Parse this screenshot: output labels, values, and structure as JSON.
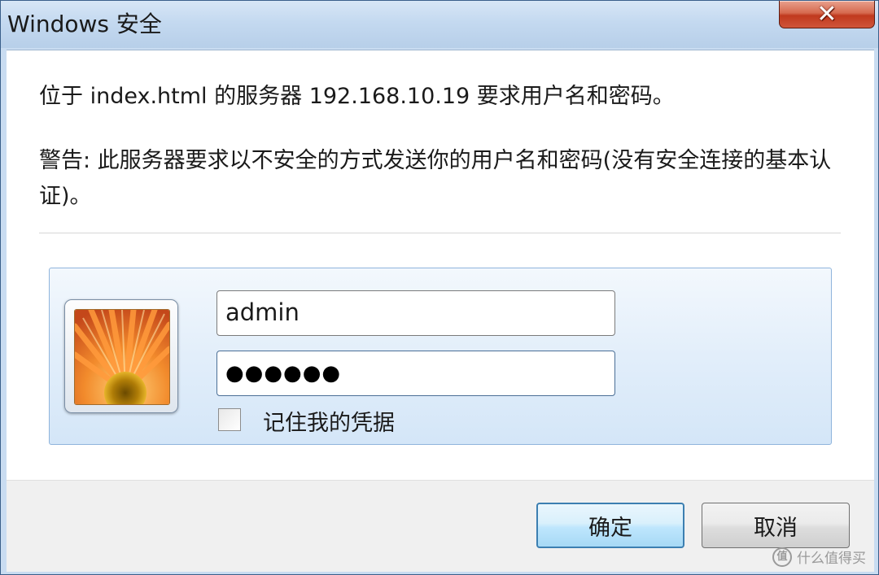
{
  "window": {
    "title": "Windows 安全",
    "close_glyph": "✕"
  },
  "dialog": {
    "message": "位于 index.html 的服务器 192.168.10.19 要求用户名和密码。",
    "warning": "警告: 此服务器要求以不安全的方式发送你的用户名和密码(没有安全连接的基本认证)。"
  },
  "credentials": {
    "avatar_icon": "user-tile-flower",
    "username_value": "admin",
    "password_value": "●●●●●●",
    "remember_checked": false,
    "remember_label": "记住我的凭据"
  },
  "buttons": {
    "ok_label": "确定",
    "cancel_label": "取消"
  },
  "watermark": {
    "text": "什么值得买",
    "logo": "值"
  },
  "colors": {
    "titlebar": "#c4d9f0",
    "close_button": "#c0391e",
    "ok_border": "#3c7fb1",
    "panel_border": "#8fb4dc"
  }
}
